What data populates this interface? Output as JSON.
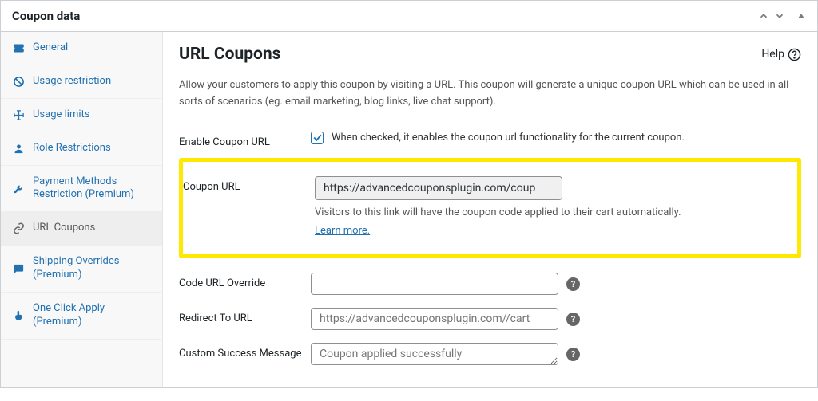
{
  "panel": {
    "title": "Coupon data"
  },
  "sidebar": {
    "items": [
      {
        "label": "General"
      },
      {
        "label": "Usage restriction"
      },
      {
        "label": "Usage limits"
      },
      {
        "label": "Role Restrictions"
      },
      {
        "label": "Payment Methods Restriction (Premium)"
      },
      {
        "label": "URL Coupons"
      },
      {
        "label": "Shipping Overrides (Premium)"
      },
      {
        "label": "One Click Apply (Premium)"
      }
    ]
  },
  "main": {
    "title": "URL Coupons",
    "help_label": "Help",
    "intro": "Allow your customers to apply this coupon by visiting a URL. This coupon will generate a unique coupon URL which can be used in all sorts of scenarios (eg. email marketing, blog links, live chat support).",
    "enable": {
      "label": "Enable Coupon URL",
      "checked": true,
      "desc": "When checked, it enables the coupon url functionality for the current coupon."
    },
    "coupon_url": {
      "label": "Coupon URL",
      "value": "https://advancedcouponsplugin.com/coup",
      "desc": "Visitors to this link will have the coupon code applied to their cart automatically.",
      "learn_more": "Learn more."
    },
    "code_override": {
      "label": "Code URL Override",
      "value": ""
    },
    "redirect": {
      "label": "Redirect To URL",
      "placeholder": "https://advancedcouponsplugin.com//cart"
    },
    "success_msg": {
      "label": "Custom Success Message",
      "placeholder": "Coupon applied successfully"
    }
  }
}
